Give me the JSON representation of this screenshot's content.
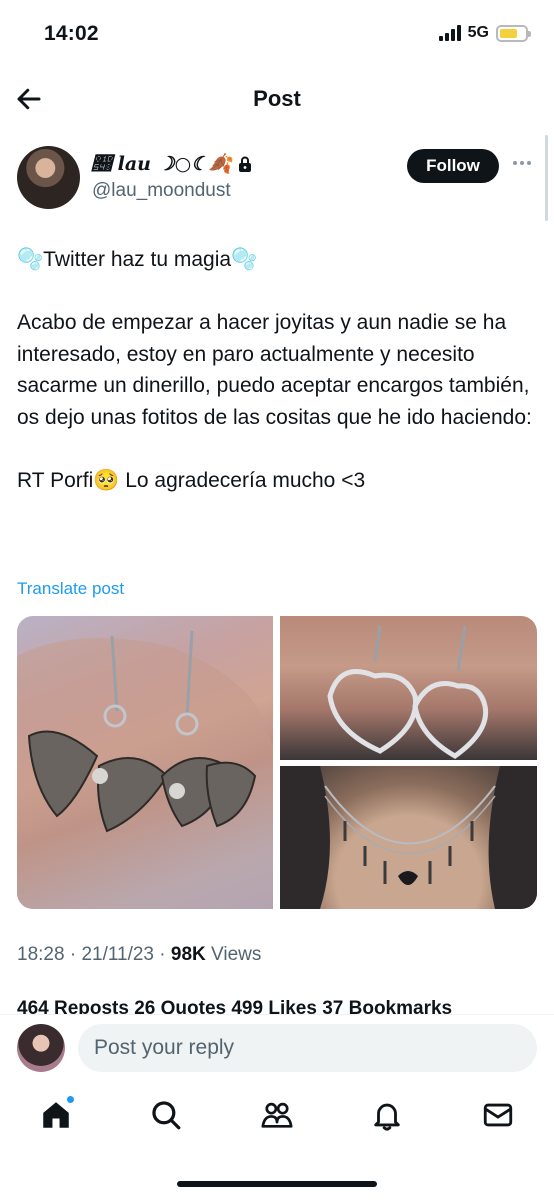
{
  "status_bar": {
    "time": "14:02",
    "network": "5G"
  },
  "header": {
    "title": "Post"
  },
  "author": {
    "display_name": "𝕈 lau ☽○☾🍂",
    "handle": "@lau_moondust",
    "follow_label": "Follow"
  },
  "post": {
    "text": "🫧Twitter haz tu magia🫧\n\nAcabo de empezar a hacer joyitas y aun nadie se ha interesado, estoy en paro actualmente y necesito sacarme un dinerillo, puedo aceptar encargos también, os dejo unas fotitos de las cositas que he ido haciendo:\n\nRT Porfi🥺 Lo agradecería mucho <3",
    "translate_label": "Translate post",
    "time": "18:28",
    "date": "21/11/23",
    "views_count": "98K",
    "views_label": "Views",
    "stats_partial": "464 Reposts  26 Quotes  499 Likes  37 Bookmarks"
  },
  "reply": {
    "placeholder": "Post your reply"
  },
  "tabs": [
    "home-icon",
    "search-icon",
    "communities-icon",
    "notifications-icon",
    "messages-icon"
  ]
}
